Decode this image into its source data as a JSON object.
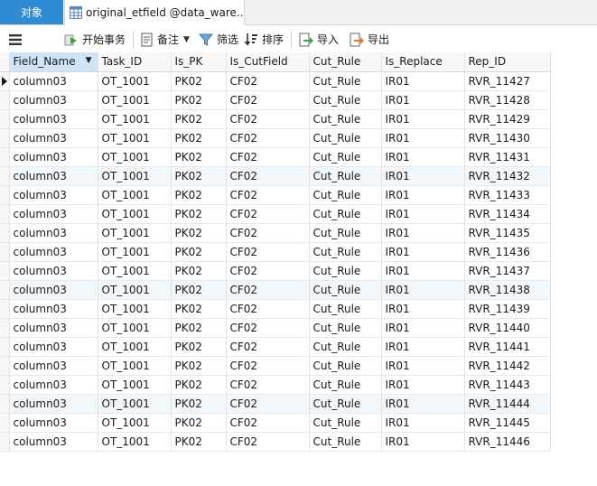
{
  "tabs": {
    "objects_label": "对象",
    "table_tab_label": "original_etfield @data_ware..."
  },
  "toolbar": {
    "menu_icon": "hamburger-icon",
    "begin_transaction_label": "开始事务",
    "memo_label": "备注",
    "filter_label": "筛选",
    "sort_label": "排序",
    "import_label": "导入",
    "export_label": "导出"
  },
  "colors": {
    "objects_tab_bg": "#2f8bd4",
    "selected_header_bg": "#cfe5f7",
    "highlight_row_bg": "#f2f7fc"
  },
  "grid": {
    "columns": [
      "Field_Name",
      "Task_ID",
      "Is_PK",
      "Is_CutField",
      "Cut_Rule",
      "Is_Replace",
      "Rep_ID"
    ],
    "sorted_column_index": 0,
    "current_row_index": 0,
    "highlight_rows": [
      5,
      11,
      17
    ],
    "rows": [
      [
        "column03",
        "OT_1001",
        "PK02",
        "CF02",
        "Cut_Rule",
        "IR01",
        "RVR_11427"
      ],
      [
        "column03",
        "OT_1001",
        "PK02",
        "CF02",
        "Cut_Rule",
        "IR01",
        "RVR_11428"
      ],
      [
        "column03",
        "OT_1001",
        "PK02",
        "CF02",
        "Cut_Rule",
        "IR01",
        "RVR_11429"
      ],
      [
        "column03",
        "OT_1001",
        "PK02",
        "CF02",
        "Cut_Rule",
        "IR01",
        "RVR_11430"
      ],
      [
        "column03",
        "OT_1001",
        "PK02",
        "CF02",
        "Cut_Rule",
        "IR01",
        "RVR_11431"
      ],
      [
        "column03",
        "OT_1001",
        "PK02",
        "CF02",
        "Cut_Rule",
        "IR01",
        "RVR_11432"
      ],
      [
        "column03",
        "OT_1001",
        "PK02",
        "CF02",
        "Cut_Rule",
        "IR01",
        "RVR_11433"
      ],
      [
        "column03",
        "OT_1001",
        "PK02",
        "CF02",
        "Cut_Rule",
        "IR01",
        "RVR_11434"
      ],
      [
        "column03",
        "OT_1001",
        "PK02",
        "CF02",
        "Cut_Rule",
        "IR01",
        "RVR_11435"
      ],
      [
        "column03",
        "OT_1001",
        "PK02",
        "CF02",
        "Cut_Rule",
        "IR01",
        "RVR_11436"
      ],
      [
        "column03",
        "OT_1001",
        "PK02",
        "CF02",
        "Cut_Rule",
        "IR01",
        "RVR_11437"
      ],
      [
        "column03",
        "OT_1001",
        "PK02",
        "CF02",
        "Cut_Rule",
        "IR01",
        "RVR_11438"
      ],
      [
        "column03",
        "OT_1001",
        "PK02",
        "CF02",
        "Cut_Rule",
        "IR01",
        "RVR_11439"
      ],
      [
        "column03",
        "OT_1001",
        "PK02",
        "CF02",
        "Cut_Rule",
        "IR01",
        "RVR_11440"
      ],
      [
        "column03",
        "OT_1001",
        "PK02",
        "CF02",
        "Cut_Rule",
        "IR01",
        "RVR_11441"
      ],
      [
        "column03",
        "OT_1001",
        "PK02",
        "CF02",
        "Cut_Rule",
        "IR01",
        "RVR_11442"
      ],
      [
        "column03",
        "OT_1001",
        "PK02",
        "CF02",
        "Cut_Rule",
        "IR01",
        "RVR_11443"
      ],
      [
        "column03",
        "OT_1001",
        "PK02",
        "CF02",
        "Cut_Rule",
        "IR01",
        "RVR_11444"
      ],
      [
        "column03",
        "OT_1001",
        "PK02",
        "CF02",
        "Cut_Rule",
        "IR01",
        "RVR_11445"
      ],
      [
        "column03",
        "OT_1001",
        "PK02",
        "CF02",
        "Cut_Rule",
        "IR01",
        "RVR_11446"
      ]
    ]
  }
}
